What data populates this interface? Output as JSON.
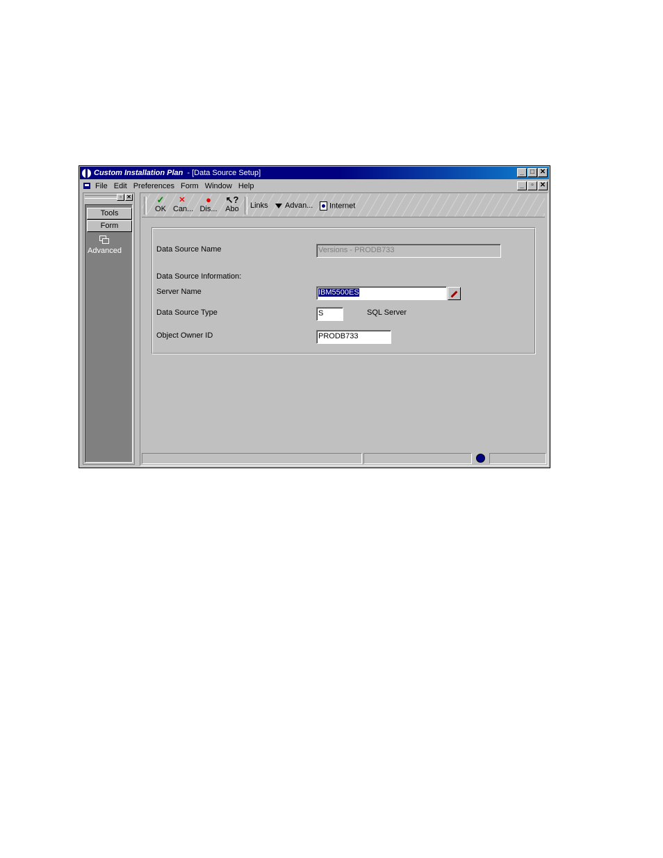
{
  "window": {
    "app_title": "Custom Installation Plan",
    "doc_title": "- [Data Source Setup]",
    "minimize": "_",
    "maximize": "□",
    "close": "✕",
    "mdi_restore": "▫"
  },
  "menu": [
    "File",
    "Edit",
    "Preferences",
    "Form",
    "Window",
    "Help"
  ],
  "left_pane": {
    "tools": "Tools",
    "form": "Form",
    "advanced": "Advanced"
  },
  "toolbar": {
    "ok": "OK",
    "cancel": "Can...",
    "display": "Dis...",
    "about": "Abo",
    "links": "Links",
    "advanced": "Advan...",
    "internet": "Internet"
  },
  "form": {
    "data_source_name_label": "Data Source Name",
    "data_source_name_value": "Versions - PRODB733",
    "info_heading": "Data Source Information:",
    "server_name_label": "Server Name",
    "server_name_value": "IBM5500ES",
    "type_label": "Data Source Type",
    "type_value": "S",
    "type_description": "SQL Server",
    "owner_label": "Object Owner ID",
    "owner_value": "PRODB733"
  }
}
